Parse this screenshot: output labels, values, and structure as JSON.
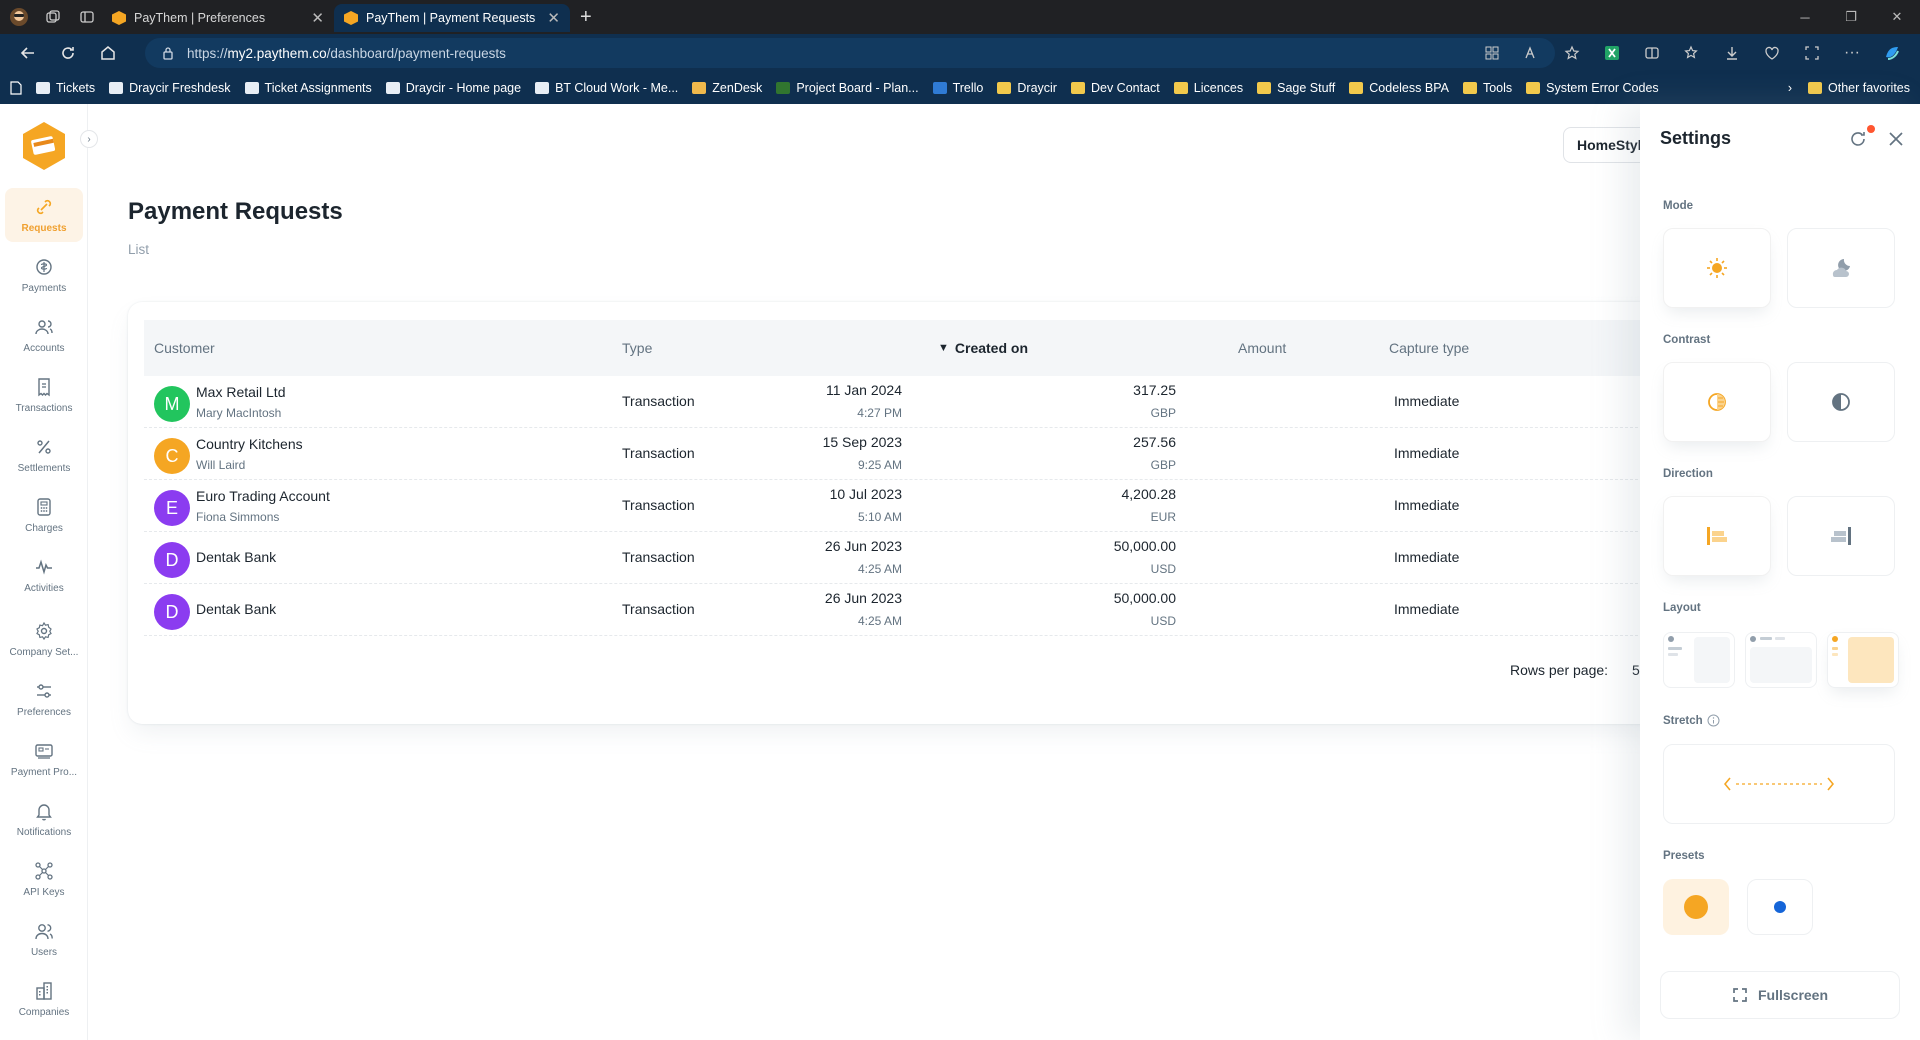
{
  "browser": {
    "tabs": [
      {
        "title": "PayThem | Preferences",
        "active": false
      },
      {
        "title": "PayThem | Payment Requests",
        "active": true
      }
    ],
    "url_prefix": "https://",
    "url_domain": "my2.paythem.co",
    "url_path": "/dashboard/payment-requests",
    "favorites": [
      {
        "label": "Tickets",
        "icon": "page-icon"
      },
      {
        "label": "Draycir Freshdesk",
        "icon": "page-icon"
      },
      {
        "label": "Ticket Assignments",
        "icon": "page-icon"
      },
      {
        "label": "Draycir - Home page",
        "icon": "page-icon"
      },
      {
        "label": "BT Cloud Work - Me...",
        "icon": "page-icon"
      },
      {
        "label": "ZenDesk",
        "icon": "zendesk-icon"
      },
      {
        "label": "Project Board - Plan...",
        "icon": "planner-icon"
      },
      {
        "label": "Trello",
        "icon": "trello-icon"
      },
      {
        "label": "Draycir",
        "icon": "folder-icon"
      },
      {
        "label": "Dev Contact",
        "icon": "folder-icon"
      },
      {
        "label": "Licences",
        "icon": "folder-icon"
      },
      {
        "label": "Sage Stuff",
        "icon": "folder-icon"
      },
      {
        "label": "Codeless BPA",
        "icon": "folder-icon"
      },
      {
        "label": "Tools",
        "icon": "folder-icon"
      },
      {
        "label": "System Error Codes",
        "icon": "folder-icon"
      }
    ],
    "other_favorites": "Other favorites"
  },
  "sidebar": {
    "items": [
      {
        "label": "Requests",
        "icon": "link-icon",
        "active": true
      },
      {
        "label": "Payments",
        "icon": "coin-icon",
        "active": false
      },
      {
        "label": "Accounts",
        "icon": "users-icon",
        "active": false
      },
      {
        "label": "Transactions",
        "icon": "receipt-icon",
        "active": false
      },
      {
        "label": "Settlements",
        "icon": "percent-icon",
        "active": false
      },
      {
        "label": "Charges",
        "icon": "calculator-icon",
        "active": false
      },
      {
        "label": "Activities",
        "icon": "pulse-icon",
        "active": false
      },
      {
        "label": "Company Set...",
        "icon": "gear-icon",
        "active": false
      },
      {
        "label": "Preferences",
        "icon": "sliders-icon",
        "active": false
      },
      {
        "label": "Payment Pro...",
        "icon": "card-reader-icon",
        "active": false
      },
      {
        "label": "Notifications",
        "icon": "bell-icon",
        "active": false
      },
      {
        "label": "API Keys",
        "icon": "nodes-icon",
        "active": false
      },
      {
        "label": "Users",
        "icon": "user-group-icon",
        "active": false
      },
      {
        "label": "Companies",
        "icon": "building-icon",
        "active": false
      }
    ]
  },
  "page": {
    "title": "Payment Requests",
    "subtitle": "List",
    "company_button": "HomeStyle"
  },
  "table": {
    "headers": {
      "customer": "Customer",
      "type": "Type",
      "created_on": "Created on",
      "amount": "Amount",
      "capture_type": "Capture type"
    },
    "rows": [
      {
        "initial": "M",
        "color": "#22c55e",
        "name": "Max Retail Ltd",
        "contact": "Mary MacIntosh",
        "type": "Transaction",
        "date": "11 Jan 2024",
        "time": "4:27 PM",
        "amount": "317.25",
        "currency": "GBP",
        "capture": "Immediate"
      },
      {
        "initial": "C",
        "color": "#f5a623",
        "name": "Country Kitchens",
        "contact": "Will Laird",
        "type": "Transaction",
        "date": "15 Sep 2023",
        "time": "9:25 AM",
        "amount": "257.56",
        "currency": "GBP",
        "capture": "Immediate"
      },
      {
        "initial": "E",
        "color": "#8b3cf0",
        "name": "Euro Trading Account",
        "contact": "Fiona Simmons",
        "type": "Transaction",
        "date": "10 Jul 2023",
        "time": "5:10 AM",
        "amount": "4,200.28",
        "currency": "EUR",
        "capture": "Immediate"
      },
      {
        "initial": "D",
        "color": "#8b3cf0",
        "name": "Dentak Bank",
        "contact": "",
        "type": "Transaction",
        "date": "26 Jun 2023",
        "time": "4:25 AM",
        "amount": "50,000.00",
        "currency": "USD",
        "capture": "Immediate"
      },
      {
        "initial": "D",
        "color": "#8b3cf0",
        "name": "Dentak Bank",
        "contact": "",
        "type": "Transaction",
        "date": "26 Jun 2023",
        "time": "4:25 AM",
        "amount": "50,000.00",
        "currency": "USD",
        "capture": "Immediate"
      }
    ],
    "rows_per_page_label": "Rows per page:",
    "rows_per_page_value": "5"
  },
  "settings": {
    "title": "Settings",
    "sections": {
      "mode": "Mode",
      "contrast": "Contrast",
      "direction": "Direction",
      "layout": "Layout",
      "stretch": "Stretch",
      "presets": "Presets"
    },
    "fullscreen_label": "Fullscreen",
    "accent_color": "#f5a623",
    "preset_colors": [
      "#f5a623",
      "#1565d8"
    ]
  }
}
